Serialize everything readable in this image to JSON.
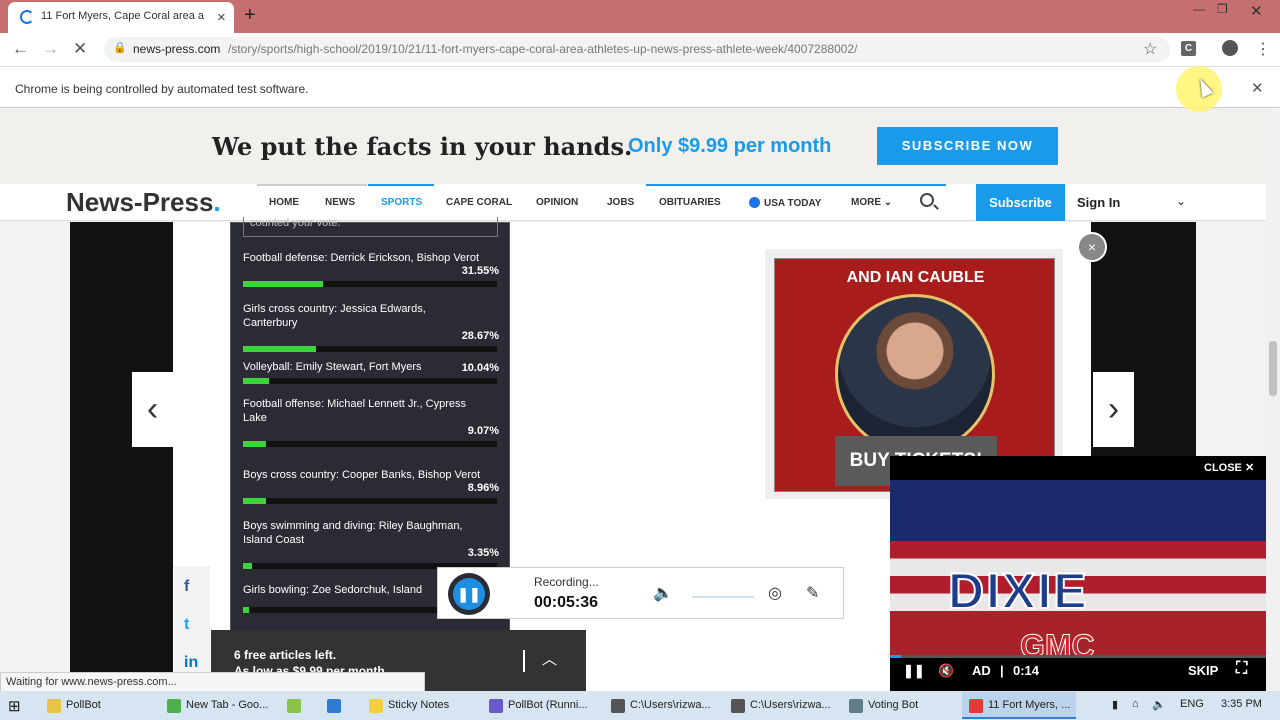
{
  "browser": {
    "tab_title": "11 Fort Myers, Cape Coral area a",
    "tab_close": "×",
    "new_tab": "+",
    "url_host": "news-press.com",
    "url_path": "/story/sports/high-school/2019/10/21/11-fort-myers-cape-coral-area-athletes-up-news-press-athlete-week/4007288002/",
    "infobar_message": "Chrome is being controlled by automated test software.",
    "extension_letter": "C",
    "status_text": "Waiting for www.news-press.com..."
  },
  "promo": {
    "headline": "We put the facts in your hands.",
    "price": "Only $9.99 per month",
    "button": "SUBSCRIBE NOW"
  },
  "site_nav": {
    "logo": "News-Press",
    "logo_dot": ".",
    "items": [
      "HOME",
      "NEWS",
      "SPORTS",
      "CAPE CORAL",
      "OPINION",
      "JOBS",
      "OBITUARIES",
      "USA TODAY",
      "MORE"
    ],
    "subscribe": "Subscribe",
    "sign_in": "Sign In"
  },
  "poll": {
    "top_text": "counted your vote.",
    "items": [
      {
        "name": "Football defense: Derrick Erickson, Bishop Verot",
        "pct": "31.55%",
        "value": 31.55
      },
      {
        "name": "Girls cross country: Jessica Edwards, Canterbury",
        "pct": "28.67%",
        "value": 28.67
      },
      {
        "name": "Volleyball: Emily Stewart, Fort Myers",
        "pct": "10.04%",
        "value": 10.04
      },
      {
        "name": "Football offense: Michael Lennett Jr., Cypress Lake",
        "pct": "9.07%",
        "value": 9.07
      },
      {
        "name": "Boys cross country: Cooper Banks, Bishop Verot",
        "pct": "8.96%",
        "value": 8.96
      },
      {
        "name": "Boys swimming and diving: Riley Baughman, Island Coast",
        "pct": "3.35%",
        "value": 3.35
      },
      {
        "name": "Girls bowling: Zoe Sedorchuk, Island",
        "pct": "",
        "value": 2.0
      }
    ]
  },
  "ad": {
    "title_prefix": "AND ",
    "title_name": "IAN CAUBLE",
    "button": "BUY TICKETS!",
    "close": "×"
  },
  "video": {
    "close_label": "CLOSE ✕",
    "brand_top": "DIXIE",
    "brand_bottom": "GMC",
    "ad_label": "AD",
    "time": "0:14",
    "skip": "SKIP",
    "progress": 0.03
  },
  "recorder": {
    "status": "Recording...",
    "time": "00:05:36"
  },
  "freebar": {
    "line1": "6 free articles left.",
    "line2": "As low as $9.99 per month."
  },
  "share": [
    "f",
    "t",
    "in"
  ],
  "taskbar": {
    "items": [
      {
        "label": "PollBot",
        "color": "#e8c54a",
        "active": false
      },
      {
        "label": "New Tab - Goo...",
        "color": "#4caf50",
        "active": false
      },
      {
        "label": "",
        "color": "#8bc34a",
        "active": false
      },
      {
        "label": "",
        "color": "#2f7bd1",
        "active": false
      },
      {
        "label": "Sticky Notes",
        "color": "#f4d03f",
        "active": false
      },
      {
        "label": "PollBot (Runni...",
        "color": "#6a5acd",
        "active": false
      },
      {
        "label": "C:\\Users\\rizwa...",
        "color": "#555",
        "active": false
      },
      {
        "label": "C:\\Users\\rizwa...",
        "color": "#555",
        "active": false
      },
      {
        "label": "Voting Bot",
        "color": "#607d8b",
        "active": false
      },
      {
        "label": "11 Fort Myers, ...",
        "color": "#e53935",
        "active": true
      }
    ],
    "lang": "ENG",
    "clock": "3:35 PM"
  }
}
